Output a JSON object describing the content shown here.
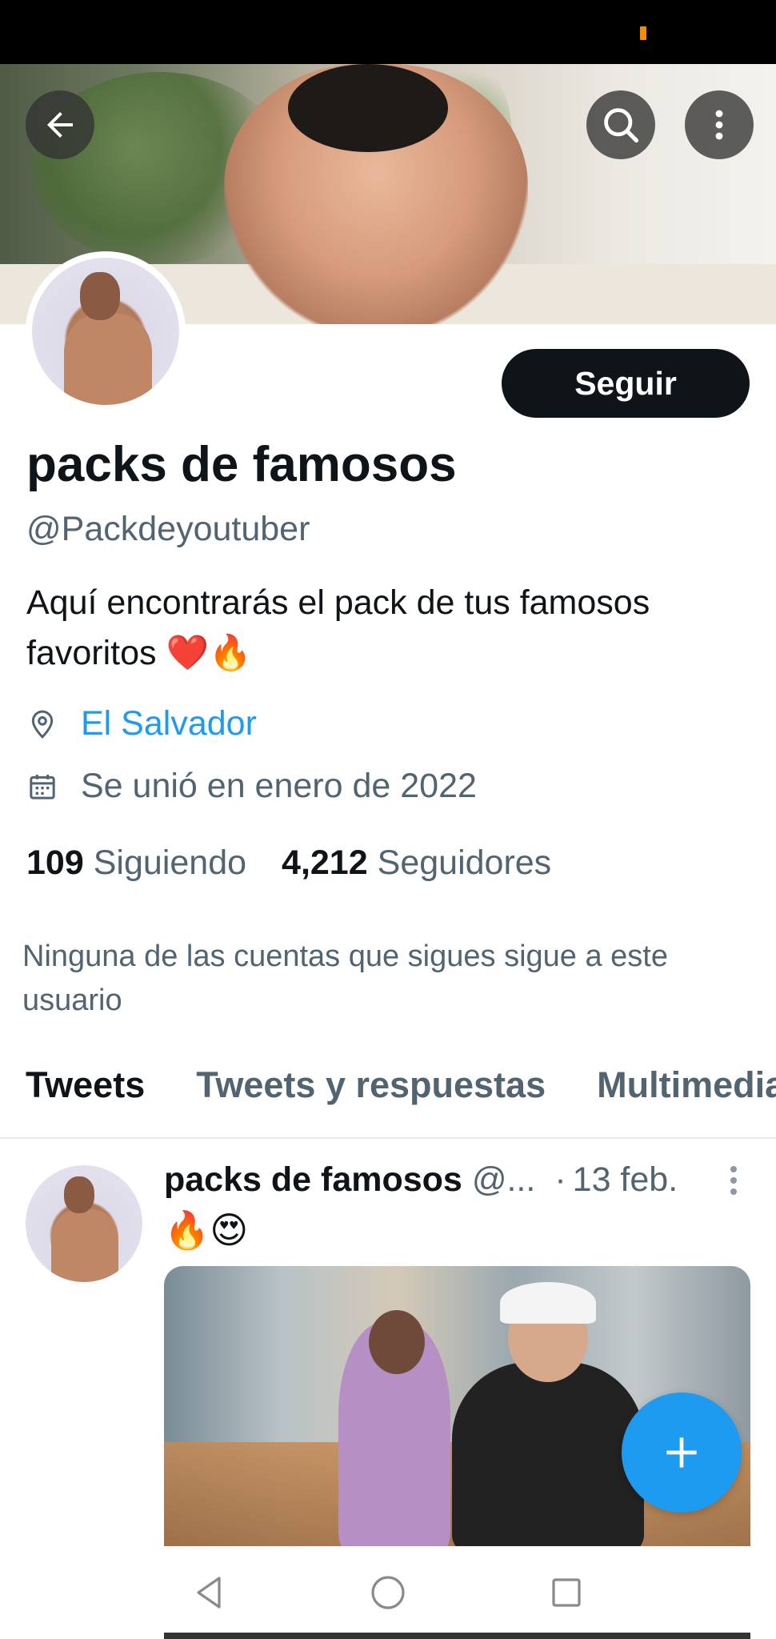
{
  "header": {
    "back_icon": "arrow-left-icon",
    "search_icon": "search-icon",
    "more_icon": "more-vertical-icon"
  },
  "profile": {
    "follow_label": "Seguir",
    "display_name": "packs de famosos",
    "handle": "@Packdeyoutuber",
    "bio": "Aquí encontrarás el pack de  tus famosos favoritos ❤️🔥",
    "location": "El Salvador",
    "joined": "Se unió en enero de 2022",
    "following_count": "109",
    "following_label": "Siguiendo",
    "followers_count": "4,212",
    "followers_label": "Seguidores",
    "mutuals_note": "Ninguna de las cuentas que sigues sigue a este usuario"
  },
  "tabs": [
    {
      "label": "Tweets",
      "active": true
    },
    {
      "label": "Tweets y respuestas",
      "active": false
    },
    {
      "label": "Multimedia",
      "active": false
    }
  ],
  "tweet": {
    "name": "packs de famosos",
    "handle": "@...",
    "separator": "·",
    "date": "13 feb.",
    "text": "🔥😍"
  },
  "colors": {
    "accent": "#1d9bf0",
    "text_primary": "#0f1419",
    "text_secondary": "#536471",
    "follow_button": "#0f1419"
  }
}
